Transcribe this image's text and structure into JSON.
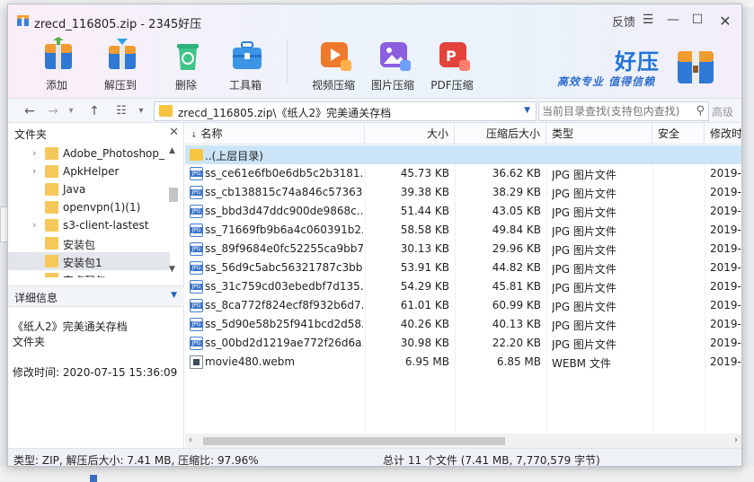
{
  "window": {
    "title": "zrecd_116805.zip - 2345好压",
    "feedback": "反馈"
  },
  "toolbar": [
    {
      "label": "添加",
      "icon": "add-archive-icon"
    },
    {
      "label": "解压到",
      "icon": "extract-icon"
    },
    {
      "label": "删除",
      "icon": "recycle-bin-icon"
    },
    {
      "label": "工具箱",
      "icon": "toolbox-icon"
    },
    {
      "label": "视频压缩",
      "icon": "video-compress-icon"
    },
    {
      "label": "图片压缩",
      "icon": "image-compress-icon"
    },
    {
      "label": "PDF压缩",
      "icon": "pdf-compress-icon"
    }
  ],
  "brand": {
    "name": "好压",
    "slogan": "高效专业  值得信赖"
  },
  "address": {
    "path": "zrecd_116805.zip\\《纸人2》完美通关存档",
    "search_placeholder": "当前目录查找(支持包内查找)",
    "advanced": "高级"
  },
  "left_panel": {
    "title": "文件夹",
    "tree": [
      {
        "name": "Adobe_Photoshop_",
        "expandable": true
      },
      {
        "name": "ApkHelper",
        "expandable": true
      },
      {
        "name": "Java",
        "expandable": false
      },
      {
        "name": "openvpn(1)(1)",
        "expandable": false
      },
      {
        "name": "s3-client-lastest",
        "expandable": true
      },
      {
        "name": "安装包",
        "expandable": false
      },
      {
        "name": "安装包1",
        "expandable": false,
        "selected": true
      },
      {
        "name": "安卓翻包",
        "expandable": true
      }
    ],
    "detail": {
      "title": "详细信息",
      "name": "《纸人2》完美通关存档",
      "type": "文件夹",
      "mtime": "修改时间:  2020-07-15 15:36:09"
    }
  },
  "list": {
    "columns": {
      "name": "名称",
      "size": "大小",
      "csize": "压缩后大小",
      "type": "类型",
      "security": "安全",
      "mtime": "修改时"
    },
    "parent_row": "..(上层目录)",
    "rows": [
      {
        "name": "ss_ce61e6fb0e6db5c2b3181...",
        "size": "45.73 KB",
        "csize": "36.62 KB",
        "type": "JPG 图片文件",
        "mtime": "2019-",
        "icon": "jpg"
      },
      {
        "name": "ss_cb138815c74a846c57363...",
        "size": "39.38 KB",
        "csize": "38.29 KB",
        "type": "JPG 图片文件",
        "mtime": "2019-",
        "icon": "jpg"
      },
      {
        "name": "ss_bbd3d47ddc900de9868c...",
        "size": "51.44 KB",
        "csize": "43.05 KB",
        "type": "JPG 图片文件",
        "mtime": "2019-",
        "icon": "jpg"
      },
      {
        "name": "ss_71669fb9b6a4c060391b2...",
        "size": "58.58 KB",
        "csize": "49.84 KB",
        "type": "JPG 图片文件",
        "mtime": "2019-",
        "icon": "jpg"
      },
      {
        "name": "ss_89f9684e0fc52255ca9bb7...",
        "size": "30.13 KB",
        "csize": "29.96 KB",
        "type": "JPG 图片文件",
        "mtime": "2019-",
        "icon": "jpg"
      },
      {
        "name": "ss_56d9c5abc56321787c3bb...",
        "size": "53.91 KB",
        "csize": "44.82 KB",
        "type": "JPG 图片文件",
        "mtime": "2019-",
        "icon": "jpg"
      },
      {
        "name": "ss_31c759cd03ebedbf7d135...",
        "size": "54.29 KB",
        "csize": "45.81 KB",
        "type": "JPG 图片文件",
        "mtime": "2019-",
        "icon": "jpg"
      },
      {
        "name": "ss_8ca772f824ecf8f932b6d7...",
        "size": "61.01 KB",
        "csize": "60.99 KB",
        "type": "JPG 图片文件",
        "mtime": "2019-",
        "icon": "jpg"
      },
      {
        "name": "ss_5d90e58b25f941bcd2d58...",
        "size": "40.26 KB",
        "csize": "40.13 KB",
        "type": "JPG 图片文件",
        "mtime": "2019-",
        "icon": "jpg"
      },
      {
        "name": "ss_00bd2d1219ae772f26d6a...",
        "size": "30.98 KB",
        "csize": "22.20 KB",
        "type": "JPG 图片文件",
        "mtime": "2019-",
        "icon": "jpg"
      },
      {
        "name": "movie480.webm",
        "size": "6.95 MB",
        "csize": "6.85 MB",
        "type": "WEBM 文件",
        "mtime": "2019-",
        "icon": "webm"
      }
    ]
  },
  "status": {
    "left": "类型: ZIP, 解压后大小: 7.41 MB, 压缩比: 97.96%",
    "right": "总计 11 个文件 (7.41 MB, 7,770,579 字节)"
  }
}
